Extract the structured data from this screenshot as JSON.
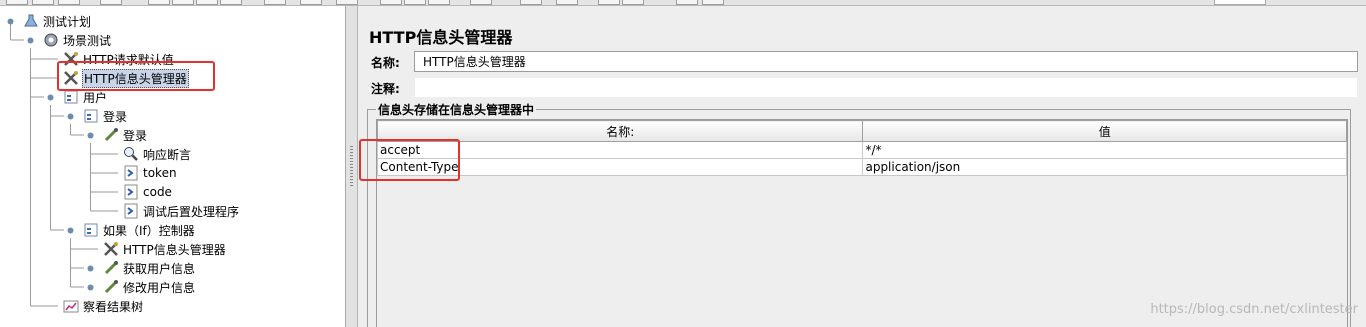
{
  "tree": {
    "items": [
      {
        "label": "测试计划",
        "icon": "flask-icon"
      },
      {
        "label": "场景测试",
        "icon": "gear-icon"
      },
      {
        "label": "HTTP请求默认值",
        "icon": "wrench-icon"
      },
      {
        "label": "HTTP信息头管理器",
        "icon": "wrench-icon"
      },
      {
        "label": "用户",
        "icon": "thread-group-icon"
      },
      {
        "label": "登录",
        "icon": "controller-icon"
      },
      {
        "label": "登录",
        "icon": "pipette-icon"
      },
      {
        "label": "响应断言",
        "icon": "magnifier-icon"
      },
      {
        "label": "token",
        "icon": "extractor-icon"
      },
      {
        "label": "code",
        "icon": "extractor-icon"
      },
      {
        "label": "调试后置处理程序",
        "icon": "extractor-icon"
      },
      {
        "label": "如果（If）控制器",
        "icon": "controller-icon"
      },
      {
        "label": "HTTP信息头管理器",
        "icon": "wrench-icon"
      },
      {
        "label": "获取用户信息",
        "icon": "pipette-icon"
      },
      {
        "label": "修改用户信息",
        "icon": "pipette-icon"
      },
      {
        "label": "察看结果树",
        "icon": "chart-icon"
      }
    ]
  },
  "panel": {
    "title": "HTTP信息头管理器",
    "name_label": "名称:",
    "name_value": "HTTP信息头管理器",
    "comment_label": "注释:",
    "group_title": "信息头存储在信息头管理器中",
    "columns": [
      "名称:",
      "值"
    ],
    "rows": [
      {
        "name": "accept",
        "value": "*/*"
      },
      {
        "name": "Content-Type",
        "value": "application/json"
      }
    ]
  },
  "watermark": "https://blog.csdn.net/cxlintester",
  "colors": {
    "highlight": "#e53030",
    "selection": "#c8d4e8"
  }
}
